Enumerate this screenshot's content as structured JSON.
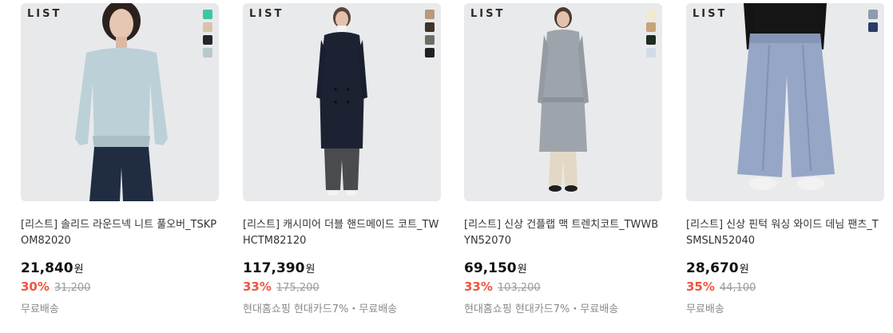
{
  "products": [
    {
      "brand": "LIST",
      "swatches": [
        "#3ec6a3",
        "#d6c3ad",
        "#23262d",
        "#b9c8cc"
      ],
      "title": "[리스트] 솔리드 라운드넥 니트 풀오버_TSKPOM82020",
      "price": "21,840",
      "currency": "원",
      "discount_rate": "30%",
      "original_price": "31,200",
      "shipping": "무료배송"
    },
    {
      "brand": "LIST",
      "swatches": [
        "#b59a7e",
        "#3e3527",
        "#6b6f64",
        "#1f2127"
      ],
      "title": "[리스트] 캐시미어 더블 핸드메이드 코트_TWHCTM82120",
      "price": "117,390",
      "currency": "원",
      "discount_rate": "33%",
      "original_price": "175,200",
      "shipping": "현대홈쇼핑 현대카드7%・무료배송"
    },
    {
      "brand": "LIST",
      "swatches": [
        "#eeebcf",
        "#c7a37c",
        "#1f2b22",
        "#d3dbe8"
      ],
      "title": "[리스트] 신상 건플랩 맥 트렌치코트_TWWBYN52070",
      "price": "69,150",
      "currency": "원",
      "discount_rate": "33%",
      "original_price": "103,200",
      "shipping": "현대홈쇼핑 현대카드7%・무료배송"
    },
    {
      "brand": "LIST",
      "swatches": [
        "#8e9ab0",
        "#2c3b66"
      ],
      "title": "[리스트] 신상 핀턱 워싱 와이드 데님 팬츠_TSMSLN52040",
      "price": "28,670",
      "currency": "원",
      "discount_rate": "35%",
      "original_price": "44,100",
      "shipping": "무료배송"
    }
  ]
}
